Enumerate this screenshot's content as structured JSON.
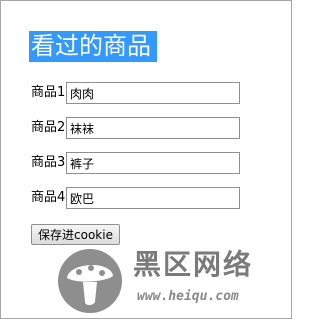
{
  "page": {
    "title": "看过的商品"
  },
  "form": {
    "fields": [
      {
        "label": "商品1",
        "value": "肉肉"
      },
      {
        "label": "商品2",
        "value": "袜袜"
      },
      {
        "label": "商品3",
        "value": "裤子"
      },
      {
        "label": "商品4",
        "value": "欧巴"
      }
    ],
    "submit_label": "保存进cookie"
  },
  "watermark": {
    "logo_text": "黑区网络",
    "url_text": "www.heiqu.com"
  },
  "colors": {
    "title_background": "#3399ff",
    "title_text": "#ffffff",
    "watermark_gray": "#7a7a7a"
  },
  "icons": {
    "watermark_logo": "mushroom-logo-icon"
  }
}
